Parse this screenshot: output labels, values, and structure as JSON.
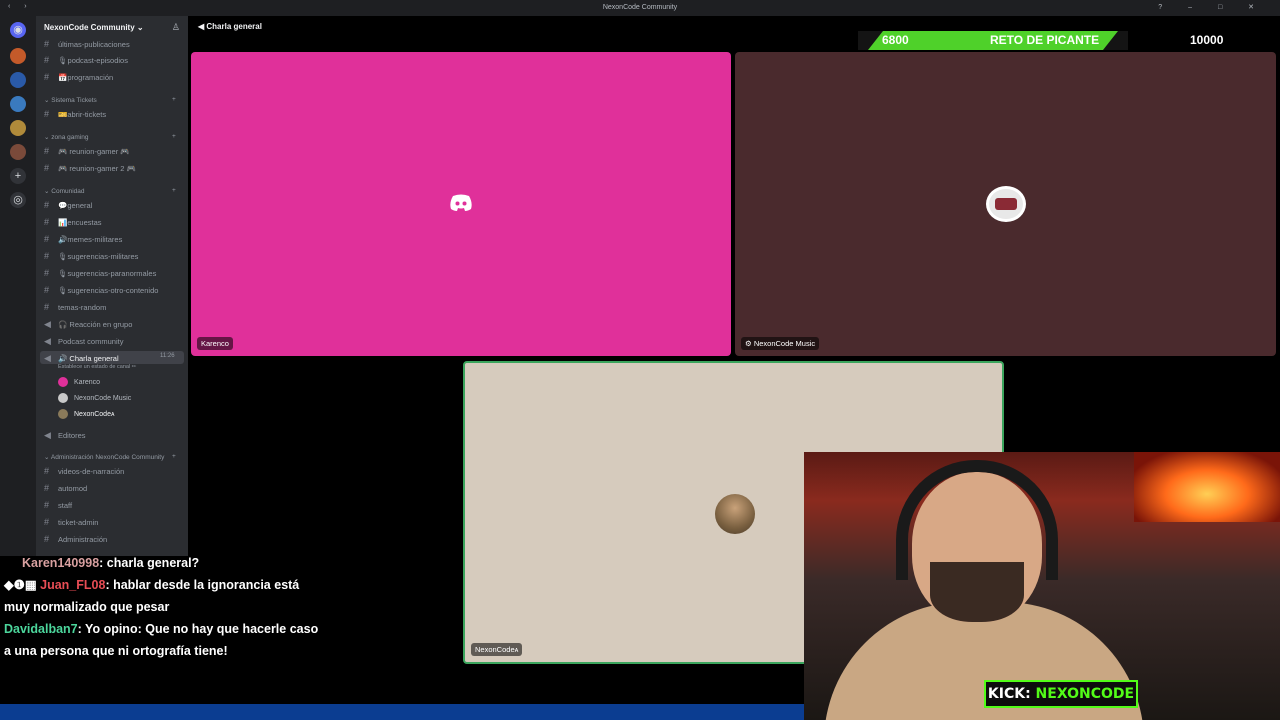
{
  "window": {
    "title": "NexonCode Community"
  },
  "server": {
    "name": "NexonCode Community"
  },
  "sidebar": {
    "channels_top": [
      {
        "name": "últimas-publicaciones"
      },
      {
        "name": "🎙podcast-episodios"
      },
      {
        "name": "📅programación"
      }
    ],
    "categories": [
      {
        "name": "Sistema Tickets"
      },
      {
        "name": "zona gaming"
      },
      {
        "name": "Comunidad"
      },
      {
        "name": "Administración NexonCode Community"
      }
    ],
    "tickets": [
      {
        "name": "🎫abrir-tickets"
      }
    ],
    "gaming": [
      {
        "name": "🎮 reunion-gamer 🎮"
      },
      {
        "name": "🎮 reunion-gamer 2 🎮"
      }
    ],
    "community": [
      {
        "name": "💬general"
      },
      {
        "name": "📊encuestas"
      },
      {
        "name": "🔊memes-militares"
      },
      {
        "name": "🎙sugerencias-militares"
      },
      {
        "name": "🎙sugerencias-paranormales"
      },
      {
        "name": "🎙sugerencias-otro-contenido"
      },
      {
        "name": "temas-random"
      },
      {
        "name": "🎧 Reacción en grupo"
      },
      {
        "name": "Podcast community"
      }
    ],
    "active_voice": {
      "name": "🔊 Charla general",
      "time": "11:26",
      "status": "Establece un estado de canal ✏"
    },
    "voice_members": [
      {
        "name": "Karenco",
        "color": "#e0309a"
      },
      {
        "name": "NexonCode Music",
        "color": "#c9c9c9"
      },
      {
        "name": "NexonCodeᴀ",
        "color": "#8a7a5a"
      }
    ],
    "after_voice": [
      {
        "name": "Editores"
      }
    ],
    "admin": [
      {
        "name": "videos-de-narración"
      },
      {
        "name": "automod"
      },
      {
        "name": "staff"
      },
      {
        "name": "ticket-admin"
      },
      {
        "name": "Administración"
      }
    ]
  },
  "voice": {
    "channel": "Charla general",
    "tiles": [
      {
        "name": "Karenco",
        "bg": "#e0309a"
      },
      {
        "name": "NexonCode Music",
        "bg": "#4a2a2d"
      },
      {
        "name": "NexonCodeᴀ",
        "bg": "#d6cbbd"
      }
    ]
  },
  "overlay": {
    "goal_current": "6800",
    "goal_label": "RETO DE PICANTE",
    "goal_target": "10000",
    "kick_prefix": "KICK:",
    "kick_name": "NEXONCODE"
  },
  "chat": [
    {
      "user": "Karen140998",
      "text": ": charla general?"
    },
    {
      "user": "Juan_FL08",
      "text": ": hablar desde la ignorancia está muy normalizado que pesar"
    },
    {
      "user": "Davidalban7",
      "text": ": Yo opino: Que no hay que hacerle caso a una persona que ni ortografía tiene!"
    }
  ]
}
